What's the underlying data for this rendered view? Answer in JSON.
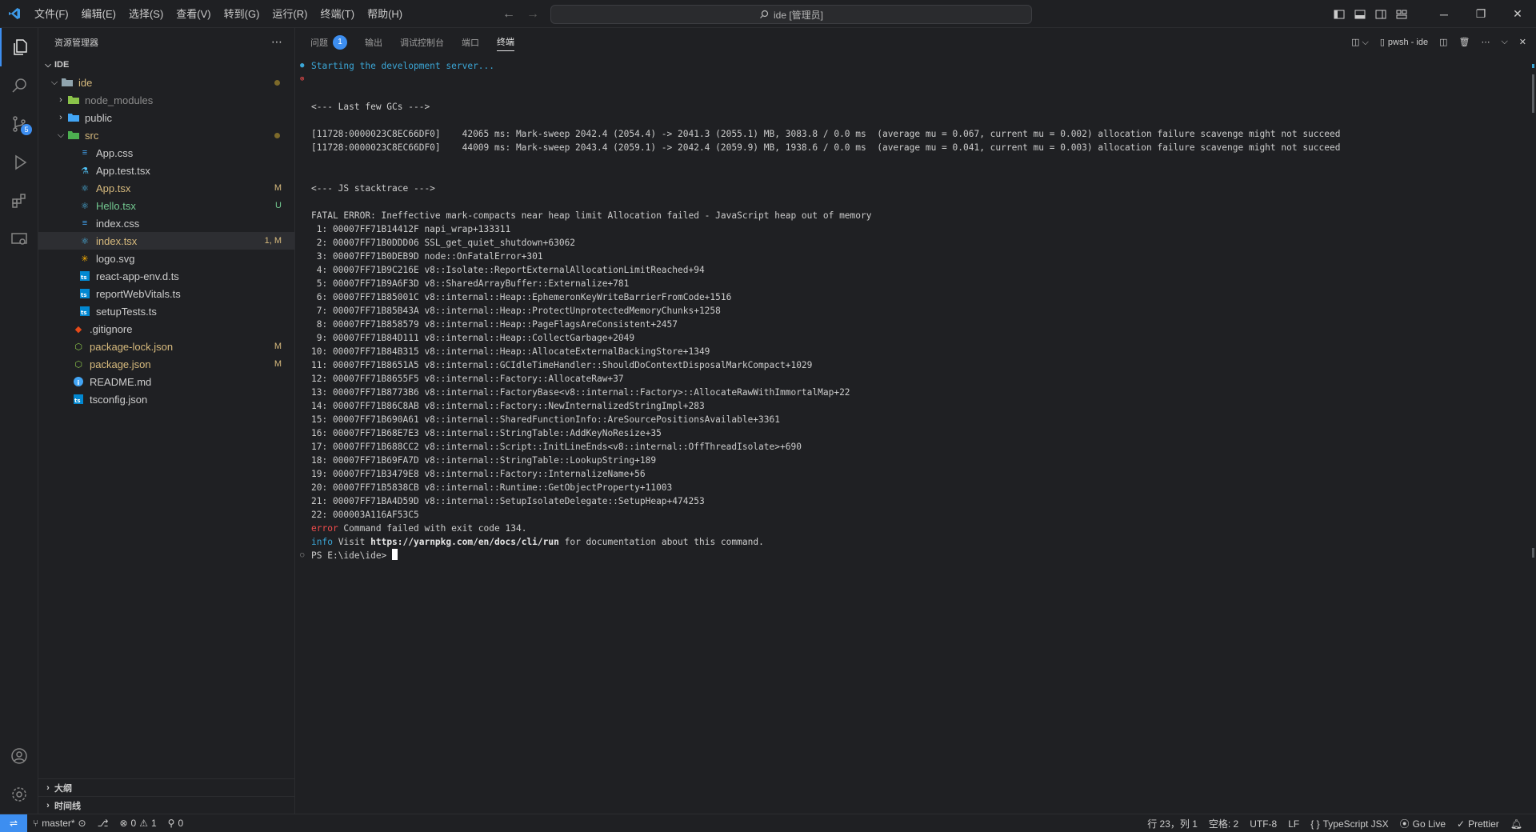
{
  "menu": [
    "文件(F)",
    "编辑(E)",
    "选择(S)",
    "查看(V)",
    "转到(G)",
    "运行(R)",
    "终端(T)",
    "帮助(H)"
  ],
  "command_center": "ide [管理员]",
  "sidebar": {
    "title": "资源管理器",
    "root": "IDE",
    "tree": [
      {
        "label": "ide",
        "status": "",
        "dot": true
      },
      {
        "label": "node_modules",
        "status": ""
      },
      {
        "label": "public",
        "status": ""
      },
      {
        "label": "src",
        "status": "",
        "dot": true
      },
      {
        "label": "App.css",
        "status": ""
      },
      {
        "label": "App.test.tsx",
        "status": ""
      },
      {
        "label": "App.tsx",
        "status": "M"
      },
      {
        "label": "Hello.tsx",
        "status": "U"
      },
      {
        "label": "index.css",
        "status": ""
      },
      {
        "label": "index.tsx",
        "status": "1, M"
      },
      {
        "label": "logo.svg",
        "status": ""
      },
      {
        "label": "react-app-env.d.ts",
        "status": ""
      },
      {
        "label": "reportWebVitals.ts",
        "status": ""
      },
      {
        "label": "setupTests.ts",
        "status": ""
      },
      {
        "label": ".gitignore",
        "status": ""
      },
      {
        "label": "package-lock.json",
        "status": "M"
      },
      {
        "label": "package.json",
        "status": "M"
      },
      {
        "label": "README.md",
        "status": ""
      },
      {
        "label": "tsconfig.json",
        "status": ""
      }
    ],
    "outline": "大纲",
    "timeline": "时间线"
  },
  "activity": {
    "scm_badge": "5"
  },
  "panel": {
    "tabs": [
      "问题",
      "输出",
      "调试控制台",
      "端口",
      "终端"
    ],
    "problems_badge": "1",
    "terminal_name": "pwsh - ide"
  },
  "terminal": {
    "starting": "Starting the development server...",
    "gc_header": "<--- Last few GCs --->",
    "gc_lines": [
      "[11728:0000023C8EC66DF0]    42065 ms: Mark-sweep 2042.4 (2054.4) -> 2041.3 (2055.1) MB, 3083.8 / 0.0 ms  (average mu = 0.067, current mu = 0.002) allocation failure scavenge might not succeed",
      "[11728:0000023C8EC66DF0]    44009 ms: Mark-sweep 2043.4 (2059.1) -> 2042.4 (2059.9) MB, 1938.6 / 0.0 ms  (average mu = 0.041, current mu = 0.003) allocation failure scavenge might not succeed"
    ],
    "js_header": "<--- JS stacktrace --->",
    "fatal": "FATAL ERROR: Ineffective mark-compacts near heap limit Allocation failed - JavaScript heap out of memory",
    "stack": [
      " 1: 00007FF71B14412F napi_wrap+133311",
      " 2: 00007FF71B0DDD06 SSL_get_quiet_shutdown+63062",
      " 3: 00007FF71B0DEB9D node::OnFatalError+301",
      " 4: 00007FF71B9C216E v8::Isolate::ReportExternalAllocationLimitReached+94",
      " 5: 00007FF71B9A6F3D v8::SharedArrayBuffer::Externalize+781",
      " 6: 00007FF71B85001C v8::internal::Heap::EphemeronKeyWriteBarrierFromCode+1516",
      " 7: 00007FF71B85B43A v8::internal::Heap::ProtectUnprotectedMemoryChunks+1258",
      " 8: 00007FF71B858579 v8::internal::Heap::PageFlagsAreConsistent+2457",
      " 9: 00007FF71B84D111 v8::internal::Heap::CollectGarbage+2049",
      "10: 00007FF71B84B315 v8::internal::Heap::AllocateExternalBackingStore+1349",
      "11: 00007FF71B8651A5 v8::internal::GCIdleTimeHandler::ShouldDoContextDisposalMarkCompact+1029",
      "12: 00007FF71B8655F5 v8::internal::Factory::AllocateRaw+37",
      "13: 00007FF71B8773B6 v8::internal::FactoryBase<v8::internal::Factory>::AllocateRawWithImmortalMap+22",
      "14: 00007FF71B86C8AB v8::internal::Factory::NewInternalizedStringImpl+283",
      "15: 00007FF71B690A61 v8::internal::SharedFunctionInfo::AreSourcePositionsAvailable+3361",
      "16: 00007FF71B68E7E3 v8::internal::StringTable::AddKeyNoResize+35",
      "17: 00007FF71B688CC2 v8::internal::Script::InitLineEnds<v8::internal::OffThreadIsolate>+690",
      "18: 00007FF71B69FA7D v8::internal::StringTable::LookupString+189",
      "19: 00007FF71B3479E8 v8::internal::Factory::InternalizeName+56",
      "20: 00007FF71B5838CB v8::internal::Runtime::GetObjectProperty+11003",
      "21: 00007FF71BA4D59D v8::internal::SetupIsolateDelegate::SetupHeap+474253",
      "22: 000003A116AF53C5"
    ],
    "error_prefix": "error",
    "error_text": " Command failed with exit code 134.",
    "info_prefix": "info",
    "info_visit": " Visit ",
    "info_url": "https://yarnpkg.com/en/docs/cli/run",
    "info_rest": " for documentation about this command.",
    "prompt": "PS E:\\ide\\ide> "
  },
  "statusbar": {
    "branch": "master*",
    "errors": "0",
    "warnings": "1",
    "ports": "0",
    "position": "行 23，列 1",
    "spaces": "空格: 2",
    "encoding": "UTF-8",
    "eol": "LF",
    "language": "TypeScript JSX",
    "golive": "Go Live",
    "prettier": "Prettier"
  },
  "colors": {
    "accent": "#3d8ef0",
    "modified": "#d7ba7d",
    "untracked": "#73c991",
    "error": "#f14c4c",
    "info": "#3ba6d6"
  }
}
